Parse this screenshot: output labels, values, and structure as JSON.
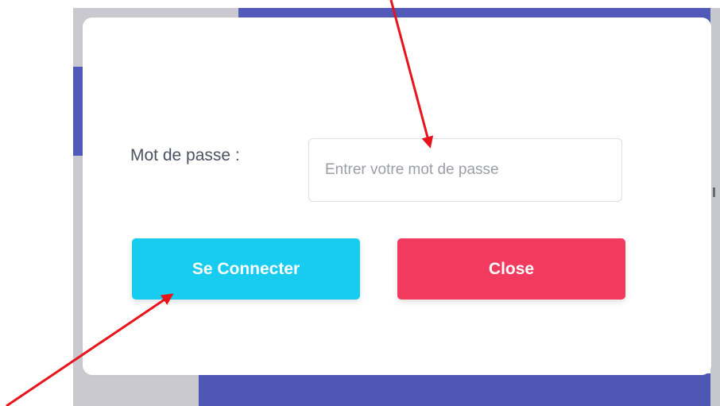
{
  "modal": {
    "password_label": "Mot de passe :",
    "password_placeholder": "Entrer votre mot de passe",
    "password_value": "",
    "connect_label": "Se Connecter",
    "close_label": "Close"
  },
  "colors": {
    "connect_button": "#17ccee",
    "close_button": "#f23a5f",
    "backdrop_blue": "#5159b9",
    "annotation_red": "#e8141c"
  }
}
